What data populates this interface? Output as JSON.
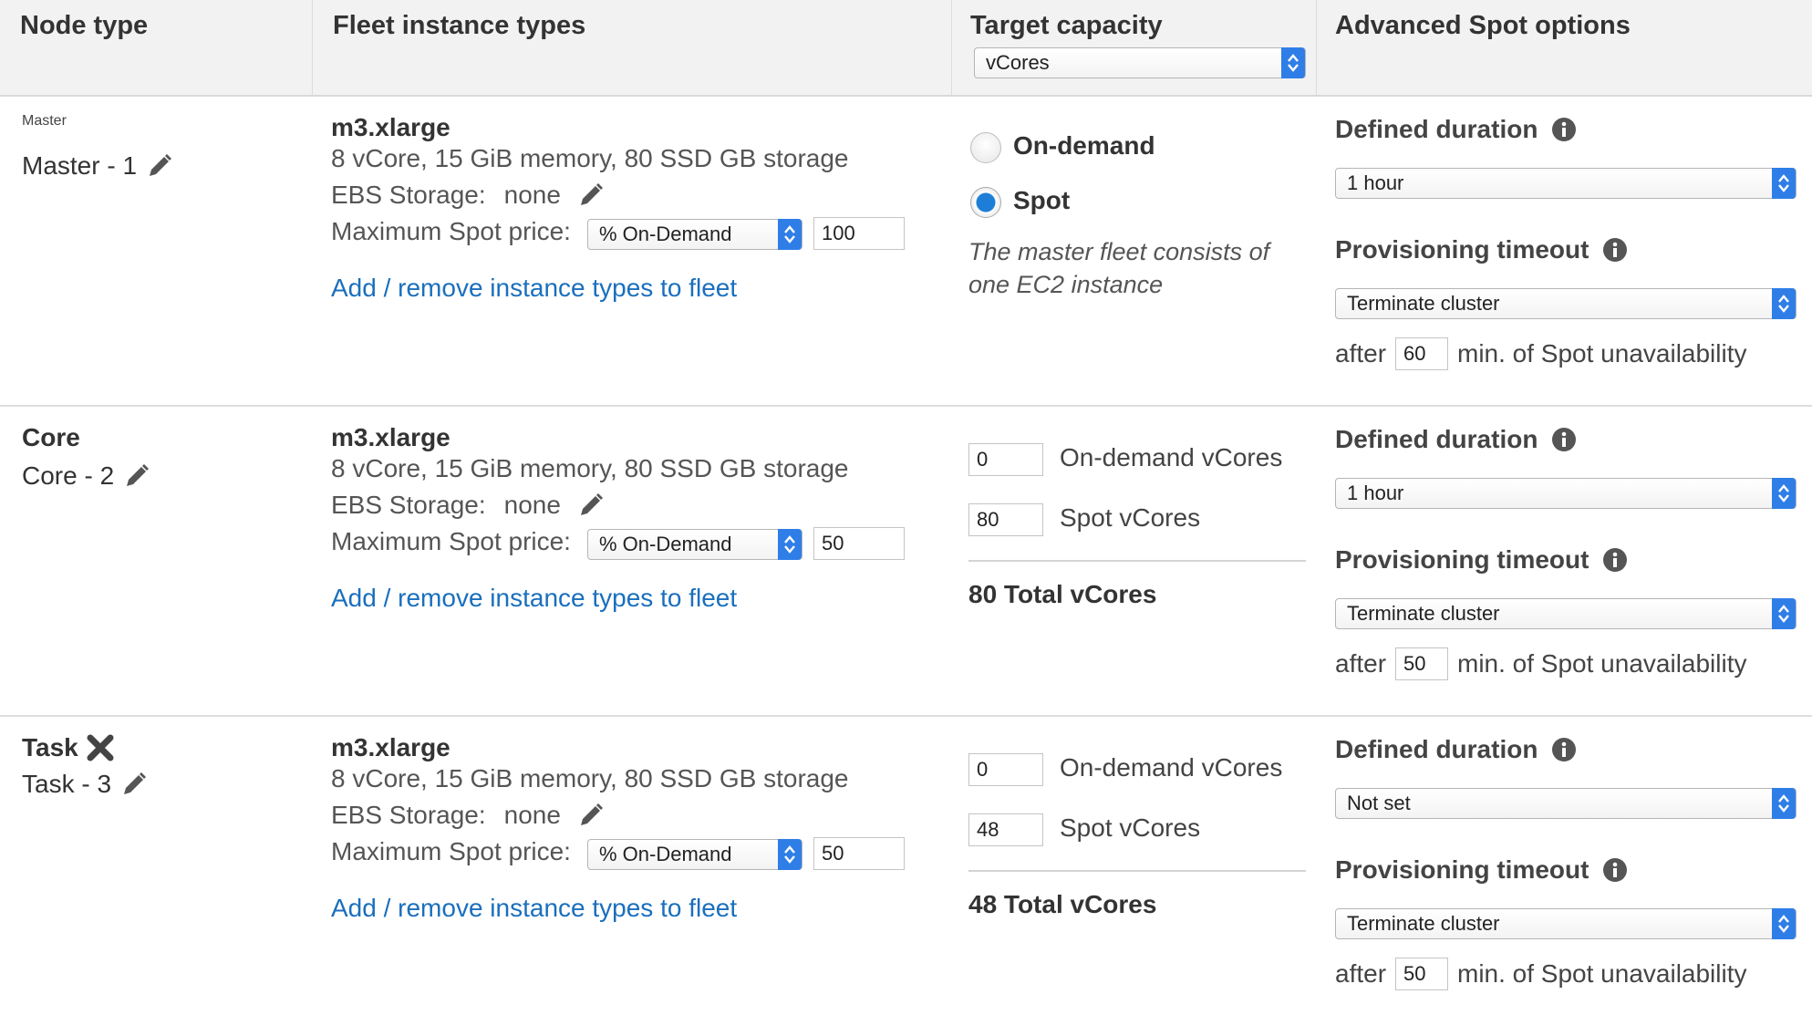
{
  "header": {
    "node_type": "Node type",
    "fleet_instance_types": "Fleet instance types",
    "target_capacity": "Target capacity",
    "target_capacity_select": "vCores",
    "advanced_spot_options": "Advanced Spot options"
  },
  "common": {
    "ebs_label": "EBS Storage:",
    "ebs_value": "none",
    "max_spot_label": "Maximum Spot price:",
    "add_remove_link": "Add / remove instance types to fleet",
    "defined_duration": "Defined duration",
    "provisioning_timeout": "Provisioning timeout",
    "after": "after",
    "min_unavailability": "min. of Spot unavailability",
    "on_demand_vcores": "On-demand vCores",
    "spot_vcores": "Spot vCores"
  },
  "rows": [
    {
      "node_title": "Master",
      "node_sub": "Master - 1",
      "instance_name": "m3.xlarge",
      "instance_specs": "8 vCore, 15 GiB memory, 80 SSD GB storage",
      "price_mode": "% On-Demand",
      "price_value": "100",
      "on_demand_label": "On-demand",
      "spot_label": "Spot",
      "selected": "Spot",
      "note": "The master fleet consists of one EC2 instance",
      "duration": "1 hour",
      "timeout_action": "Terminate cluster",
      "after_minutes": "60"
    },
    {
      "node_title": "Core",
      "node_sub": "Core - 2",
      "instance_name": "m3.xlarge",
      "instance_specs": "8 vCore, 15 GiB memory, 80 SSD GB storage",
      "price_mode": "% On-Demand",
      "price_value": "50",
      "on_demand_vcores": "0",
      "spot_vcores": "80",
      "total": "80 Total vCores",
      "duration": "1 hour",
      "timeout_action": "Terminate cluster",
      "after_minutes": "50"
    },
    {
      "node_title": "Task",
      "node_sub": "Task - 3",
      "instance_name": "m3.xlarge",
      "instance_specs": "8 vCore, 15 GiB memory, 80 SSD GB storage",
      "price_mode": "% On-Demand",
      "price_value": "50",
      "on_demand_vcores": "0",
      "spot_vcores": "48",
      "total": "48 Total vCores",
      "duration": "Not set",
      "timeout_action": "Terminate cluster",
      "after_minutes": "50"
    }
  ],
  "colors": {
    "link": "#1a6fbd",
    "select_accent": "#2f7ee8",
    "radio_selected": "#1c7ed6",
    "header_bg": "#f2f2f2"
  }
}
